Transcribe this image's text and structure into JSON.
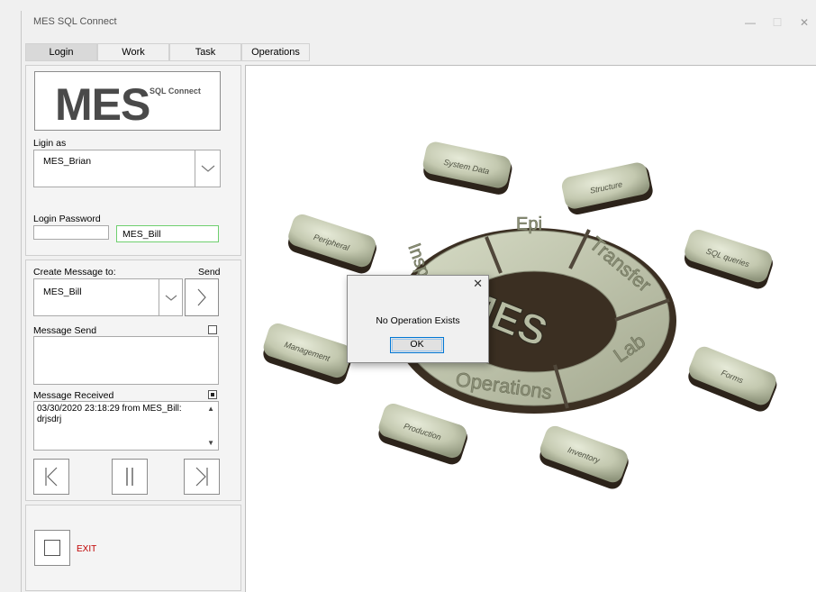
{
  "window": {
    "title": "MES SQL Connect",
    "controls": {
      "minimize": "—",
      "maximize": "☐",
      "close": "✕"
    }
  },
  "tabs": [
    "Login",
    "Work",
    "Task",
    "Operations"
  ],
  "logo": {
    "big": "MES",
    "small": "SQL Connect"
  },
  "login": {
    "login_as_label": "Ligin as",
    "user_value": "MES_Brian",
    "password_label": "Login Password",
    "password_value": "",
    "user_badge": "MES_Bill"
  },
  "message": {
    "create_label": "Create Message to:",
    "send_label": "Send",
    "recipient_value": "MES_Bill",
    "message_send_label": "Message Send",
    "message_send_value": "",
    "message_received_label": "Message Received",
    "received_line1": "03/30/2020  23:18:29 from MES_Bill:",
    "received_line2": "drjsdrj"
  },
  "exit": {
    "label": "EXIT",
    "color": "#c00000"
  },
  "diagram": {
    "center": "MES",
    "ring": [
      "Epi",
      "Transfer",
      "Lab",
      "Operations",
      "Insp"
    ],
    "tiles": [
      "System Data",
      "Structure",
      "SQL queries",
      "Forms",
      "Inventory",
      "Production",
      "Management",
      "Peripheral"
    ]
  },
  "dialog": {
    "message": "No Operation Exists",
    "ok_label": "OK",
    "close": "✕"
  }
}
